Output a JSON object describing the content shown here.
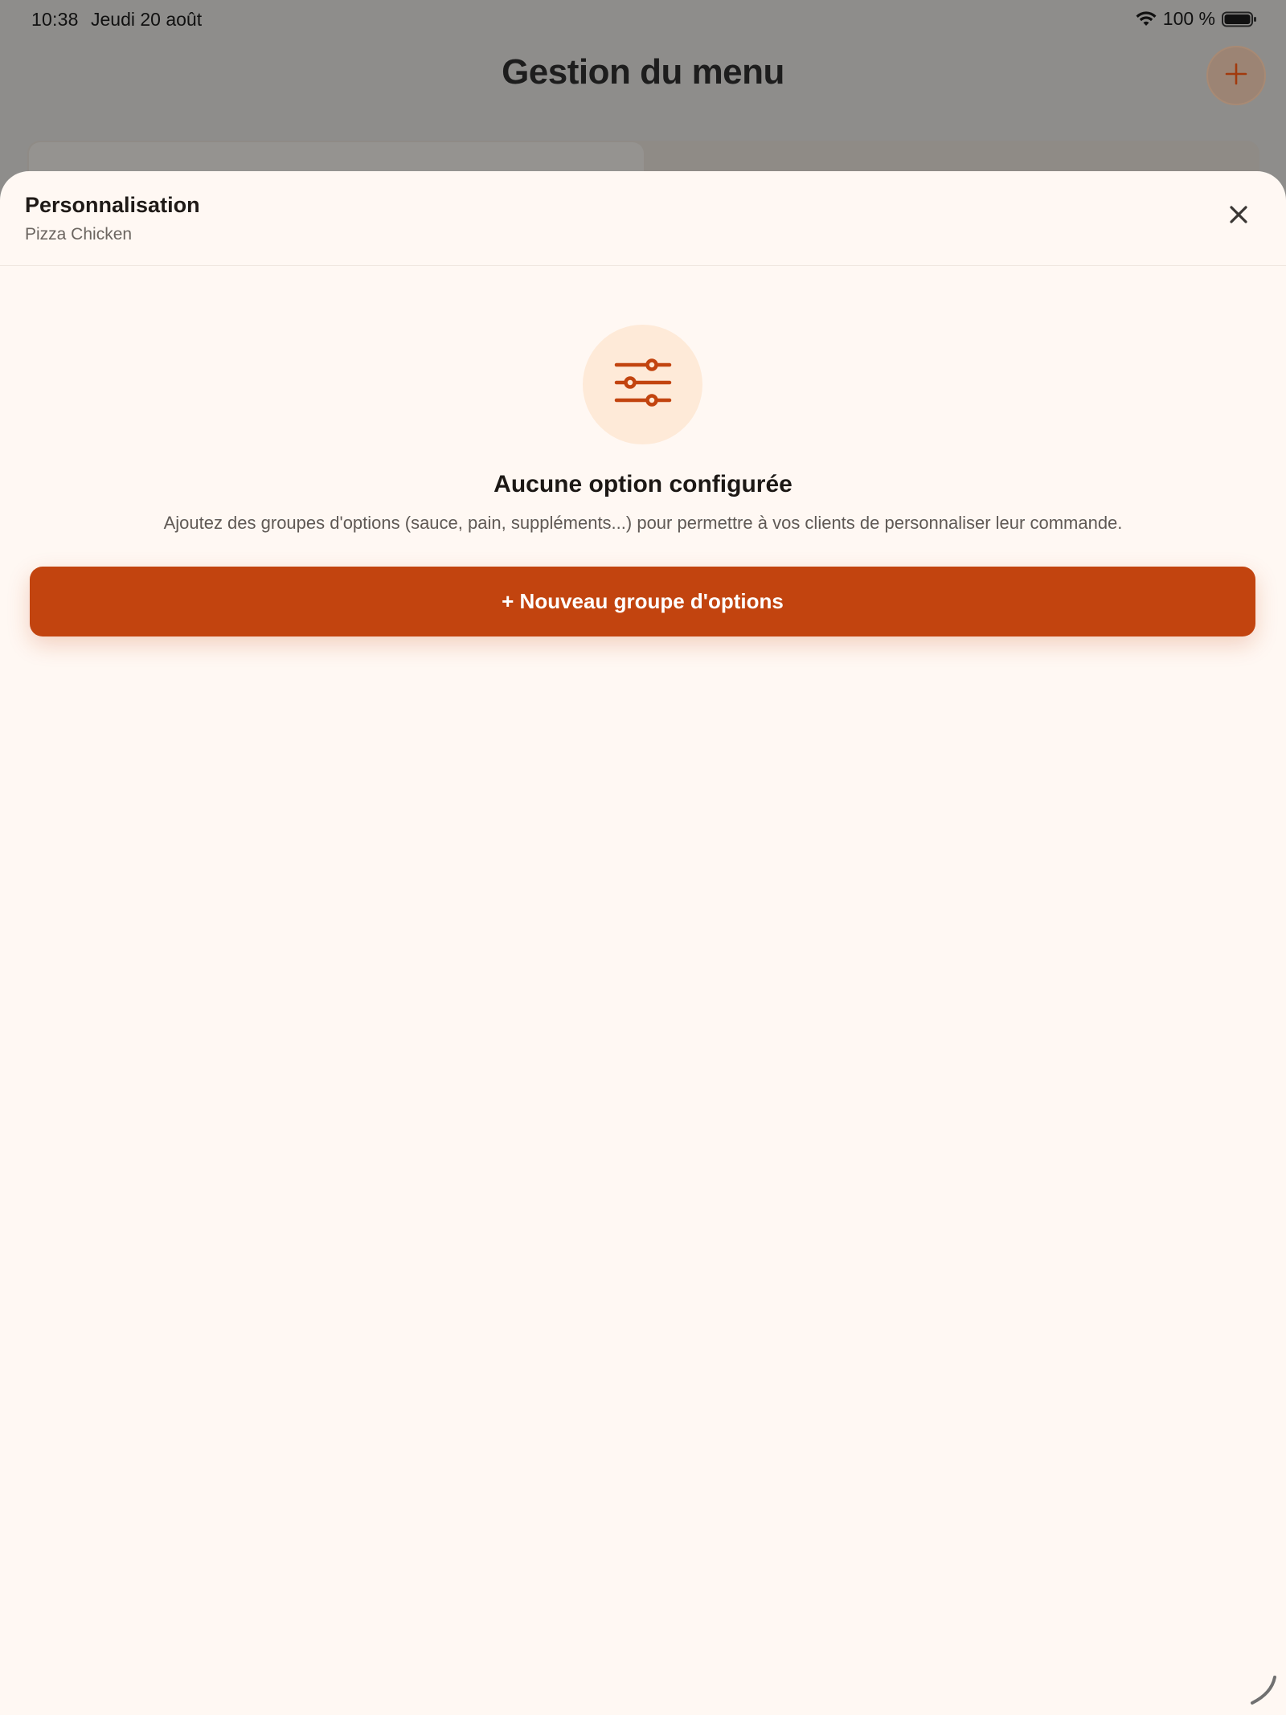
{
  "status_bar": {
    "time": "10:38",
    "date": "Jeudi 20 août",
    "battery": "100 %"
  },
  "background_screen": {
    "title": "Gestion du menu",
    "add_icon": "plus-icon"
  },
  "sheet": {
    "title": "Personnalisation",
    "subtitle": "Pizza Chicken",
    "close_icon": "close-icon",
    "empty_state": {
      "icon": "sliders-icon",
      "title": "Aucune option configurée",
      "description": "Ajoutez des groupes d'options (sauce, pain, suppléments...) pour permettre à vos clients de personnaliser leur commande."
    },
    "primary_button_label": "+ Nouveau groupe d'options"
  },
  "colors": {
    "accent": "#c2440f",
    "sheet_background": "#fff8f3",
    "icon_circle": "#feead8",
    "scrim": "#8e8d8b"
  }
}
